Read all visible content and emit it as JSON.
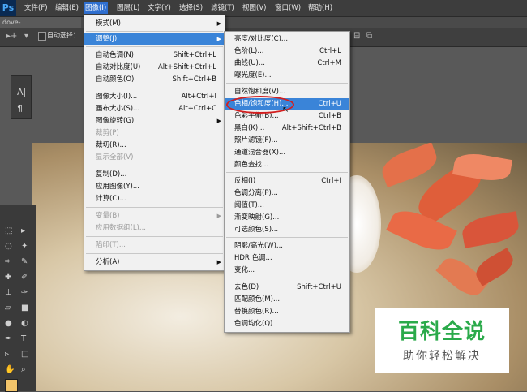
{
  "app": {
    "logo": "Ps"
  },
  "menubar": {
    "items": [
      "文件(F)",
      "编辑(E)",
      "图像(I)",
      "图层(L)",
      "文字(Y)",
      "选择(S)",
      "滤镜(T)",
      "视图(V)",
      "窗口(W)",
      "帮助(H)"
    ],
    "active_index": 2
  },
  "document": {
    "tab_title": "dove-2516641_960_720.j"
  },
  "options_bar": {
    "auto_select_label": "自动选择："
  },
  "image_menu": {
    "items": [
      {
        "label": "模式(M)",
        "shortcut": "",
        "submenu": true,
        "disabled": false
      },
      {
        "label": "调整(J)",
        "shortcut": "",
        "submenu": true,
        "disabled": false,
        "highlighted": true
      },
      {
        "label": "自动色调(N)",
        "shortcut": "Shift+Ctrl+L",
        "disabled": false
      },
      {
        "label": "自动对比度(U)",
        "shortcut": "Alt+Shift+Ctrl+L",
        "disabled": false
      },
      {
        "label": "自动颜色(O)",
        "shortcut": "Shift+Ctrl+B",
        "disabled": false
      },
      {
        "label": "图像大小(I)...",
        "shortcut": "Alt+Ctrl+I",
        "disabled": false
      },
      {
        "label": "画布大小(S)...",
        "shortcut": "Alt+Ctrl+C",
        "disabled": false
      },
      {
        "label": "图像旋转(G)",
        "shortcut": "",
        "submenu": true,
        "disabled": false
      },
      {
        "label": "裁剪(P)",
        "shortcut": "",
        "disabled": true
      },
      {
        "label": "裁切(R)...",
        "shortcut": "",
        "disabled": false
      },
      {
        "label": "显示全部(V)",
        "shortcut": "",
        "disabled": true
      },
      {
        "label": "复制(D)...",
        "shortcut": "",
        "disabled": false
      },
      {
        "label": "应用图像(Y)...",
        "shortcut": "",
        "disabled": false
      },
      {
        "label": "计算(C)...",
        "shortcut": "",
        "disabled": false
      },
      {
        "label": "变量(B)",
        "shortcut": "",
        "submenu": true,
        "disabled": true
      },
      {
        "label": "应用数据组(L)...",
        "shortcut": "",
        "disabled": true
      },
      {
        "label": "陷印(T)...",
        "shortcut": "",
        "disabled": true
      },
      {
        "label": "分析(A)",
        "shortcut": "",
        "submenu": true,
        "disabled": false
      }
    ]
  },
  "adjust_menu": {
    "items": [
      {
        "label": "亮度/对比度(C)...",
        "shortcut": ""
      },
      {
        "label": "色阶(L)...",
        "shortcut": "Ctrl+L"
      },
      {
        "label": "曲线(U)...",
        "shortcut": "Ctrl+M"
      },
      {
        "label": "曝光度(E)...",
        "shortcut": ""
      },
      {
        "label": "自然饱和度(V)...",
        "shortcut": ""
      },
      {
        "label": "色相/饱和度(H)...",
        "shortcut": "Ctrl+U",
        "highlighted": true
      },
      {
        "label": "色彩平衡(B)...",
        "shortcut": "Ctrl+B"
      },
      {
        "label": "黑白(K)...",
        "shortcut": "Alt+Shift+Ctrl+B"
      },
      {
        "label": "照片滤镜(F)...",
        "shortcut": ""
      },
      {
        "label": "通道混合器(X)...",
        "shortcut": ""
      },
      {
        "label": "颜色查找...",
        "shortcut": ""
      },
      {
        "label": "反相(I)",
        "shortcut": "Ctrl+I"
      },
      {
        "label": "色调分离(P)...",
        "shortcut": ""
      },
      {
        "label": "阈值(T)...",
        "shortcut": ""
      },
      {
        "label": "渐变映射(G)...",
        "shortcut": ""
      },
      {
        "label": "可选颜色(S)...",
        "shortcut": ""
      },
      {
        "label": "阴影/高光(W)...",
        "shortcut": ""
      },
      {
        "label": "HDR 色调...",
        "shortcut": ""
      },
      {
        "label": "变化...",
        "shortcut": ""
      },
      {
        "label": "去色(D)",
        "shortcut": "Shift+Ctrl+U"
      },
      {
        "label": "匹配颜色(M)...",
        "shortcut": ""
      },
      {
        "label": "替换颜色(R)...",
        "shortcut": ""
      },
      {
        "label": "色调均化(Q)",
        "shortcut": ""
      }
    ]
  },
  "watermark": {
    "title": "百科全说",
    "subtitle": "助你轻松解决"
  },
  "colors": {
    "menu_highlight": "#3a84d8",
    "annotation": "#d21e1e",
    "watermark_green": "#2aaa4a"
  },
  "icons": [
    "move-tool-icon",
    "checkbox-icon",
    "character-panel-icon",
    "paragraph-icon",
    "cursor-icon"
  ]
}
